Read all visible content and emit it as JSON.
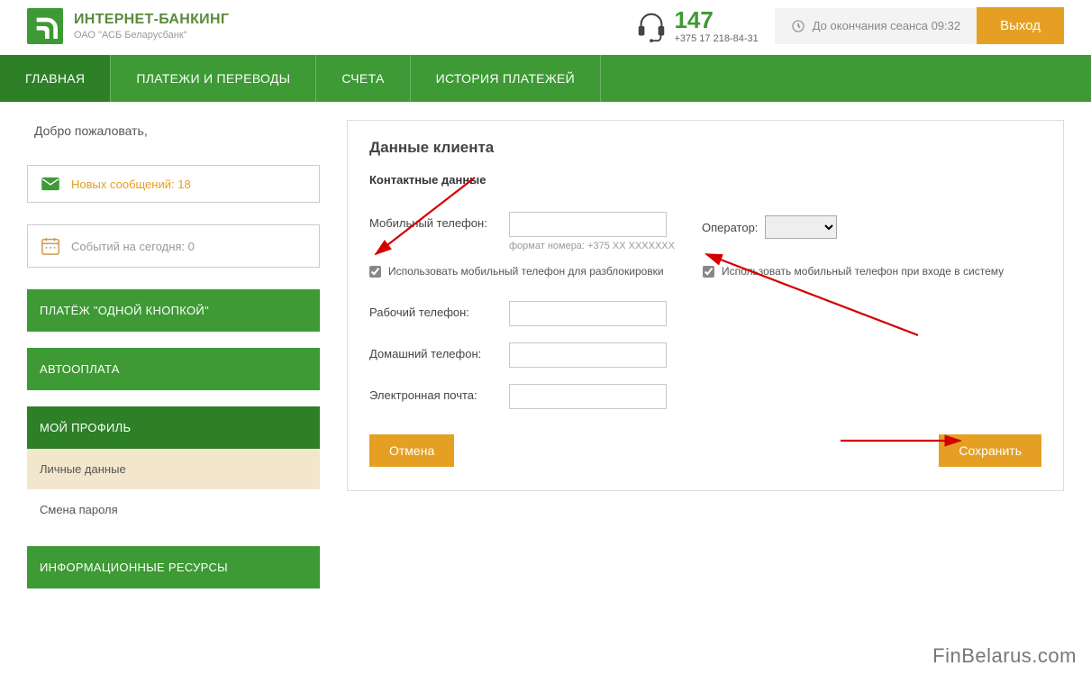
{
  "header": {
    "brand_title": "ИНТЕРНЕТ-БАНКИНГ",
    "brand_sub": "ОАО \"АСБ Беларусбанк\"",
    "support_short": "147",
    "support_phone": "+375 17 218-84-31",
    "session_label": "До окончания сеанса 09:32",
    "logout": "Выход"
  },
  "nav": {
    "main": "ГЛАВНАЯ",
    "payments": "ПЛАТЕЖИ И ПЕРЕВОДЫ",
    "accounts": "СЧЕТА",
    "history": "ИСТОРИЯ ПЛАТЕЖЕЙ"
  },
  "sidebar": {
    "welcome": "Добро пожаловать,",
    "messages_label": "Новых сообщений: 18",
    "events_label": "Событий на сегодня: 0",
    "menu": {
      "one_click": "ПЛАТЁЖ \"ОДНОЙ КНОПКОЙ\"",
      "autopay": "АВТООПЛАТА",
      "profile": "МОЙ ПРОФИЛЬ",
      "personal": "Личные данные",
      "password": "Смена пароля",
      "resources": "ИНФОРМАЦИОННЫЕ РЕСУРСЫ"
    }
  },
  "panel": {
    "title": "Данные клиента",
    "section": "Контактные данные",
    "mobile_label": "Мобильный телефон:",
    "format_hint": "формат номера: +375 XX XXXXXXX",
    "operator_label": "Оператор:",
    "check_unblock": "Использовать мобильный телефон для разблокировки",
    "check_login": "Использовать мобильный телефон при входе в систему",
    "work_label": "Рабочий телефон:",
    "home_label": "Домашний телефон:",
    "email_label": "Электронная почта:",
    "cancel": "Отмена",
    "save": "Сохранить"
  },
  "watermark": "FinBelarus.com"
}
